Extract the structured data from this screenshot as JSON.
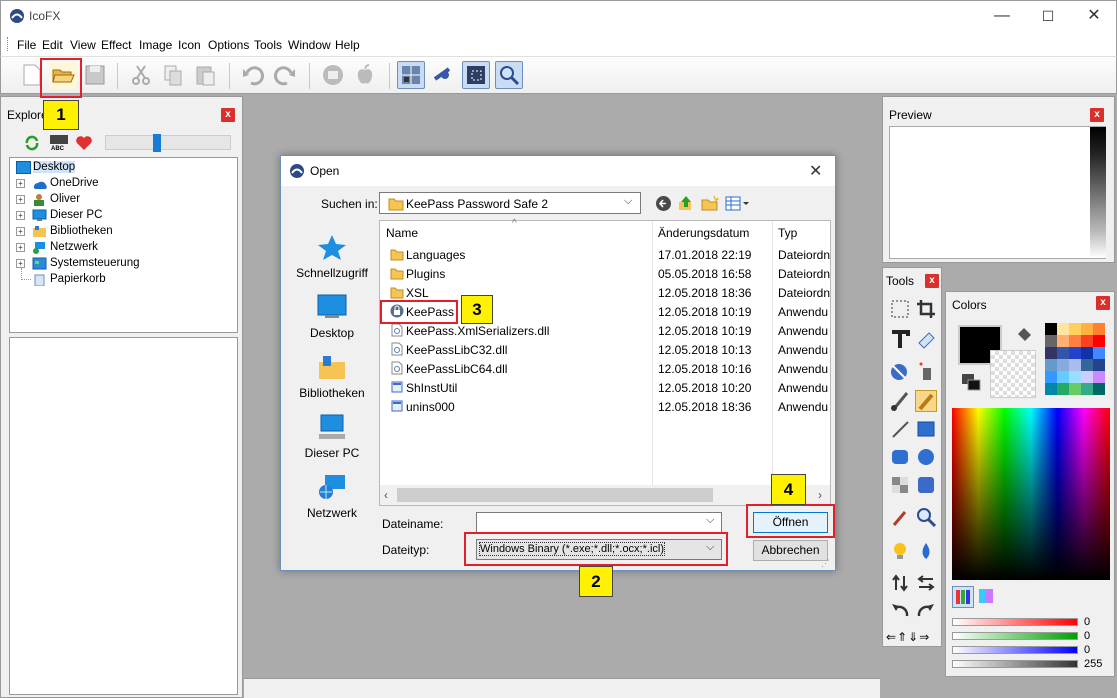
{
  "app": {
    "title": "IcoFX"
  },
  "window_controls": {
    "minimize": "—",
    "maximize": "☐",
    "close": "✕"
  },
  "menu": [
    "File",
    "Edit",
    "View",
    "Effect",
    "Image",
    "Icon",
    "Options",
    "Tools",
    "Window",
    "Help"
  ],
  "explorer": {
    "title": "Explorer",
    "tree": [
      {
        "label": "Desktop",
        "expand": ""
      },
      {
        "label": "OneDrive",
        "expand": "+"
      },
      {
        "label": "Oliver",
        "expand": "+"
      },
      {
        "label": "Dieser PC",
        "expand": "+"
      },
      {
        "label": "Bibliotheken",
        "expand": "+"
      },
      {
        "label": "Netzwerk",
        "expand": "+"
      },
      {
        "label": "Systemsteuerung",
        "expand": "+"
      },
      {
        "label": "Papierkorb",
        "expand": ""
      }
    ]
  },
  "preview": {
    "title": "Preview"
  },
  "tools": {
    "title": "Tools"
  },
  "colors": {
    "title": "Colors",
    "sliders": [
      {
        "value": "0",
        "color": "#ff0000",
        "level": 1
      },
      {
        "value": "0",
        "color": "#00a000",
        "level": 1
      },
      {
        "value": "0",
        "color": "#0000ff",
        "level": 1
      },
      {
        "value": "255",
        "color": "#555555",
        "level": 1
      }
    ]
  },
  "dialog": {
    "title": "Open",
    "lookin_label": "Suchen in:",
    "lookin_value": "KeePass Password Safe 2",
    "nav": [
      "Schnellzugriff",
      "Desktop",
      "Bibliotheken",
      "Dieser PC",
      "Netzwerk"
    ],
    "columns": [
      "Name",
      "Änderungsdatum",
      "Typ"
    ],
    "files": [
      {
        "name": "Languages",
        "date": "17.01.2018 22:19",
        "type": "Dateiordn",
        "kind": "folder"
      },
      {
        "name": "Plugins",
        "date": "05.05.2018 16:58",
        "type": "Dateiordn",
        "kind": "folder"
      },
      {
        "name": "XSL",
        "date": "12.05.2018 18:36",
        "type": "Dateiordn",
        "kind": "folder"
      },
      {
        "name": "KeePass",
        "date": "12.05.2018 10:19",
        "type": "Anwendu",
        "kind": "app"
      },
      {
        "name": "KeePass.XmlSerializers.dll",
        "date": "12.05.2018 10:19",
        "type": "Anwendu",
        "kind": "dll"
      },
      {
        "name": "KeePassLibC32.dll",
        "date": "12.05.2018 10:13",
        "type": "Anwendu",
        "kind": "dll"
      },
      {
        "name": "KeePassLibC64.dll",
        "date": "12.05.2018 10:16",
        "type": "Anwendu",
        "kind": "dll"
      },
      {
        "name": "ShInstUtil",
        "date": "12.05.2018 10:20",
        "type": "Anwendu",
        "kind": "exe"
      },
      {
        "name": "unins000",
        "date": "12.05.2018 18:36",
        "type": "Anwendu",
        "kind": "exe"
      }
    ],
    "filename_label": "Dateiname:",
    "filename_value": "",
    "filetype_label": "Dateityp:",
    "filetype_value": "Windows Binary (*.exe;*.dll;*.ocx;*.icl)",
    "open_button": "Öffnen",
    "cancel_button": "Abbrechen"
  },
  "annotations": [
    "1",
    "2",
    "3",
    "4"
  ],
  "accent_red": "#e0202a",
  "badge_yellow": "#fff200"
}
